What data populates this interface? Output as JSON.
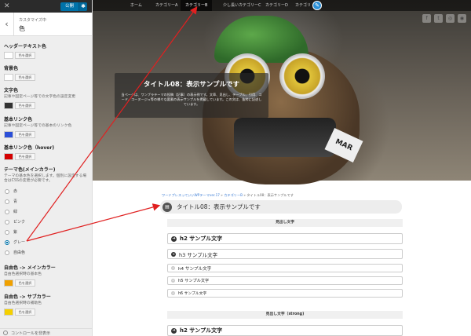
{
  "sidebar": {
    "publish_label": "公開",
    "gear_symbol": "✱",
    "close_symbol": "✕",
    "back_symbol": "‹",
    "breadcrumb": "カスタマイズ中",
    "section_title": "色",
    "controls": [
      {
        "title": "ヘッダーテキスト色",
        "desc": "",
        "swatch": "#ffffff",
        "button": "色を選択"
      },
      {
        "title": "背景色",
        "desc": "",
        "swatch": "#ffffff",
        "button": "色を選択"
      },
      {
        "title": "文字色",
        "desc": "記事や固定ページ等での文字色の設定変更",
        "swatch": "#333333",
        "button": "色を選択"
      },
      {
        "title": "基本リンク色",
        "desc": "記事や固定ページ等での基本のリンク色",
        "swatch": "#2b4fd8",
        "button": "色を選択"
      },
      {
        "title": "基本リンク色（hover)",
        "desc": "",
        "swatch": "#d40000",
        "button": "色を選択"
      }
    ],
    "theme_color": {
      "title": "テーマ色(メインカラー)",
      "desc": "テーマの基本色を選択します。個別に設定する場合はCSSの変更が必要です。",
      "options": [
        "赤",
        "青",
        "緑",
        "ピンク",
        "紫",
        "グレー",
        "自由色"
      ],
      "selected": "グレー"
    },
    "free_main": {
      "title": "自由色 -> メインカラー",
      "desc": "自由色選択時の基本色",
      "swatch": "#f0a000",
      "button": "色を選択"
    },
    "free_sub": {
      "title": "自由色 -> サブカラー",
      "desc": "自由色選択時の補助色",
      "swatch": "#f5d000",
      "button": "色を選択"
    },
    "bottom_text": "コントロールを非表示"
  },
  "preview": {
    "nav": [
      "ホーム",
      "カテゴリーA",
      "カテゴリーB",
      "少し長いカテゴリーC",
      "カテゴリーD",
      "カテゴリ"
    ],
    "active_nav": "カテゴリーB",
    "edit_symbol": "✎",
    "social": [
      "f",
      "t",
      "◎",
      "◉"
    ],
    "hero_tag": "MAR",
    "hero_title": "タイトル08：表示サンプルです",
    "hero_text": "当ページは、ワンブラテーマの投稿（記事）の表示例です。文章、見出し、テーブル、引用、コード、コーヌージュ等の様々な要素の表示サンプルを掲載しています。この文は、抜粋に記述しています。",
    "breadcrumb_link1": "ワードプレスっていいWPテーマver.17",
    "breadcrumb_sep": "»",
    "breadcrumb_link2": "カテゴリーB",
    "breadcrumb_current": "タイトル08：表示サンプルです",
    "post_icon": "▤",
    "post_title": "タイトル08：表示サンプルです",
    "section1_label": "見出し文字",
    "headings": [
      {
        "tag": "h2",
        "text": "h2 サンプル文字"
      },
      {
        "tag": "h3",
        "text": "h3 サンプル文字"
      },
      {
        "tag": "h4",
        "text": "h4 サンプル文字"
      },
      {
        "tag": "h5",
        "text": "h5 サンプル文字"
      },
      {
        "tag": "h6",
        "text": "h6 サンプル文字"
      }
    ],
    "section2_label": "見出し文字（strong)",
    "heading_strong": "h2 サンプル文字",
    "arrow_symbol": "➜"
  },
  "colors": {
    "accent": "#0073aa",
    "annotation": "#e02020"
  }
}
